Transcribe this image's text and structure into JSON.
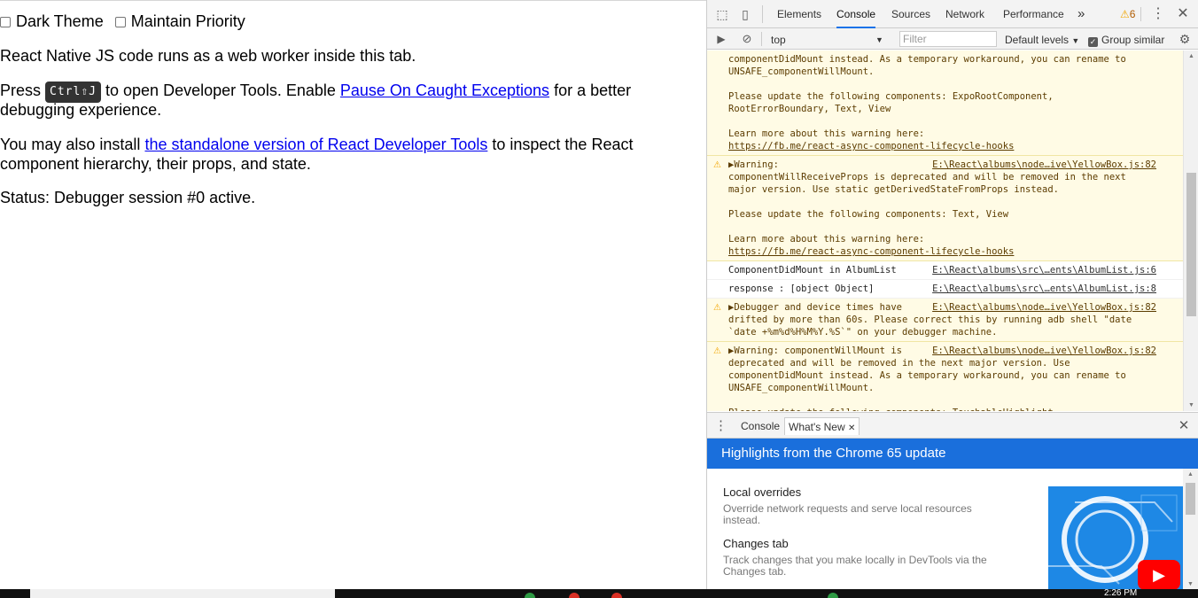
{
  "page": {
    "dark_theme_label": "Dark Theme",
    "maintain_priority_label": "Maintain Priority",
    "line1": "React Native JS code runs as a web worker inside this tab.",
    "line2_prefix": "Press",
    "shortcut": "Ctrl⇧J",
    "line2_mid": "to open Developer Tools. Enable",
    "line2_link": "Pause On Caught Exceptions",
    "line2_suffix": "for a better",
    "line2_cont": "debugging experience.",
    "line3_prefix": "You may also install",
    "line3_link": "the standalone version of React Developer Tools",
    "line3_suffix": "to inspect the React",
    "line3_cont": "component hierarchy, their props, and state.",
    "status": "Status: Debugger session #0 active."
  },
  "devtools": {
    "tabs": [
      "Elements",
      "Console",
      "Sources",
      "Network",
      "Performance"
    ],
    "active_tab": "Console",
    "more_tabs": "»",
    "warning_count": "6",
    "context": "top",
    "filter_placeholder": "Filter",
    "levels": "Default levels",
    "group_similar": "Group similar",
    "messages": [
      {
        "type": "warn",
        "src": "",
        "lines": [
          "componentDidMount instead. As a temporary workaround, you can rename to",
          "UNSAFE_componentWillMount.",
          "",
          "Please update the following components: ExpoRootComponent,",
          "RootErrorBoundary, Text, View",
          "",
          "Learn more about this warning here:"
        ],
        "link": "https://fb.me/react-async-component-lifecycle-hooks"
      },
      {
        "type": "warn",
        "src": "E:\\React\\albums\\node…ive\\YellowBox.js:82",
        "lines": [
          "▶Warning:",
          "componentWillReceiveProps is deprecated and will be removed in the next",
          "major version. Use static getDerivedStateFromProps instead.",
          "",
          "Please update the following components: Text, View",
          "",
          "Learn more about this warning here:"
        ],
        "link": "https://fb.me/react-async-component-lifecycle-hooks"
      },
      {
        "type": "info",
        "src": "E:\\React\\albums\\src\\…ents\\AlbumList.js:6",
        "lines": [
          "ComponentDidMount in AlbumList"
        ],
        "link": ""
      },
      {
        "type": "info",
        "src": "E:\\React\\albums\\src\\…ents\\AlbumList.js:8",
        "lines": [
          "response : [object Object]"
        ],
        "link": ""
      },
      {
        "type": "warn",
        "src": "E:\\React\\albums\\node…ive\\YellowBox.js:82",
        "lines": [
          "▶Debugger and device times have",
          "drifted by more than 60s. Please correct this by running adb shell \"date",
          "`date +%m%d%H%M%Y.%S`\" on your debugger machine."
        ],
        "link": ""
      },
      {
        "type": "warn",
        "src": "E:\\React\\albums\\node…ive\\YellowBox.js:82",
        "lines": [
          "▶Warning: componentWillMount is",
          "deprecated and will be removed in the next major version. Use",
          "componentDidMount instead. As a temporary workaround, you can rename to",
          "UNSAFE_componentWillMount.",
          "",
          "Please update the following components: TouchableHighlight"
        ],
        "link": ""
      }
    ],
    "drawer_tabs": [
      "Console",
      "What's New"
    ],
    "banner": "Highlights from the Chrome 65 update",
    "whats_new": [
      {
        "title": "Local overrides",
        "desc": "Override network requests and serve local resources instead."
      },
      {
        "title": "Changes tab",
        "desc": "Track changes that you make locally in DevTools via the Changes tab."
      }
    ]
  },
  "taskbar": {
    "clock": "2:26 PM"
  },
  "colors": {
    "link": "#0000ee",
    "devtools_accent": "#1a73e8",
    "banner": "#1a6fdc",
    "warn_bg": "#fffbe5"
  }
}
